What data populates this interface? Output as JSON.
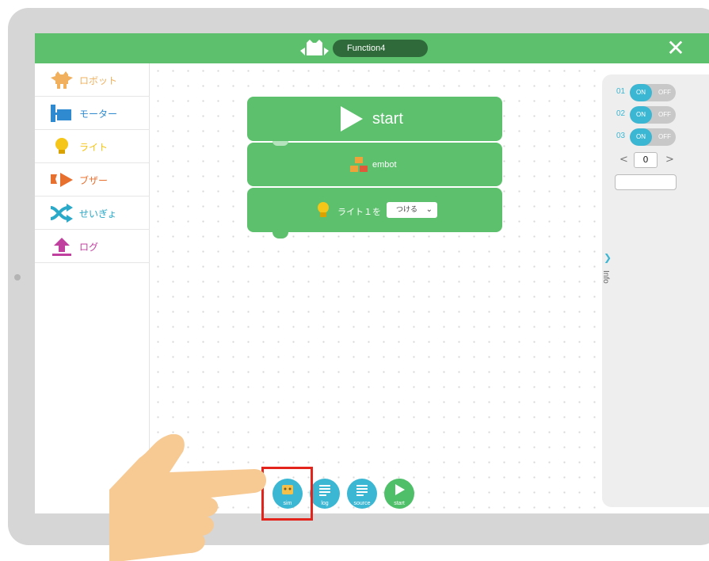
{
  "header": {
    "app_icon": "robot-icon",
    "title": "Function4",
    "close_icon": "close-icon"
  },
  "sidebar": {
    "items": [
      {
        "label": "ロボット",
        "icon": "robot-icon",
        "color": "#f0b05e"
      },
      {
        "label": "モーター",
        "icon": "motor-icon",
        "color": "#2f8ad0"
      },
      {
        "label": "ライト",
        "icon": "lightbulb-icon",
        "color": "#f5c518"
      },
      {
        "label": "ブザー",
        "icon": "buzzer-icon",
        "color": "#e8702f"
      },
      {
        "label": "せいぎょ",
        "icon": "shuffle-icon",
        "color": "#2aa9c8"
      },
      {
        "label": "ログ",
        "icon": "upload-icon",
        "color": "#c040a0"
      }
    ]
  },
  "blocks": {
    "start_label": "start",
    "embot_label": "embot",
    "light_label": "ライト１を",
    "light_option": "つける"
  },
  "info_panel": {
    "tab_label": "Info",
    "rows": [
      {
        "num": "01",
        "on": "ON",
        "off": "OFF"
      },
      {
        "num": "02",
        "on": "ON",
        "off": "OFF"
      },
      {
        "num": "03",
        "on": "ON",
        "off": "OFF"
      }
    ],
    "stepper_value": "0",
    "stepper_left": "<",
    "stepper_right": ">"
  },
  "bottom_buttons": [
    {
      "label": "sim",
      "icon": "robot-face-icon"
    },
    {
      "label": "log",
      "icon": "lines-icon"
    },
    {
      "label": "source",
      "icon": "lines-icon"
    },
    {
      "label": "start",
      "icon": "play-icon"
    }
  ],
  "colors": {
    "accent_green": "#5cc06d",
    "accent_blue": "#3bb7d3",
    "highlight_red": "#e2241d"
  }
}
